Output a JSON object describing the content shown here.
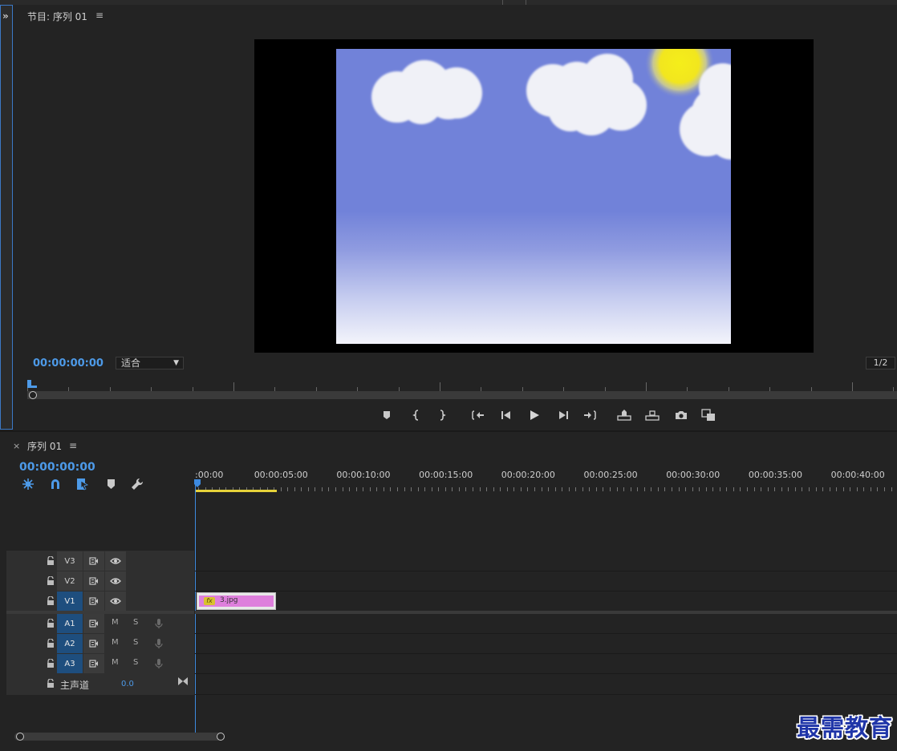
{
  "program_monitor": {
    "title": "节目: 序列 01",
    "menu_icon": "≡",
    "expand_icon": "»",
    "timecode": "00:00:00:00",
    "zoom_select": "适合",
    "resolution_select": "1/2",
    "transport_controls": [
      "add-marker",
      "mark-in",
      "mark-out",
      "go-to-in",
      "step-back",
      "play",
      "step-forward",
      "go-to-out",
      "lift",
      "extract",
      "export-frame",
      "comparison-view"
    ]
  },
  "timeline": {
    "close_icon": "×",
    "title": "序列 01",
    "menu_icon": "≡",
    "timecode": "00:00:00:00",
    "tools": [
      "snap-nested-sequence",
      "snap-magnet",
      "linked-selection",
      "add-marker",
      "timeline-settings-wrench"
    ],
    "ruler_labels": [
      ":00:00",
      "00:00:05:00",
      "00:00:10:00",
      "00:00:15:00",
      "00:00:20:00",
      "00:00:25:00",
      "00:00:30:00",
      "00:00:35:00",
      "00:00:40:00"
    ],
    "video_tracks": [
      {
        "label": "V3",
        "targeted": false
      },
      {
        "label": "V2",
        "targeted": false
      },
      {
        "label": "V1",
        "targeted": true
      }
    ],
    "audio_tracks": [
      {
        "label": "A1",
        "mute": "M",
        "solo": "S"
      },
      {
        "label": "A2",
        "mute": "M",
        "solo": "S"
      },
      {
        "label": "A3",
        "mute": "M",
        "solo": "S"
      }
    ],
    "master": {
      "label": "主声道",
      "value": "0.0"
    },
    "clip": {
      "name": "3.jpg",
      "fx": "fx",
      "color": "#de7fdc"
    }
  },
  "colors": {
    "accent": "#4d9ae8",
    "panel": "#232323",
    "work_area": "#e6d23a"
  },
  "watermark": "最需教育"
}
